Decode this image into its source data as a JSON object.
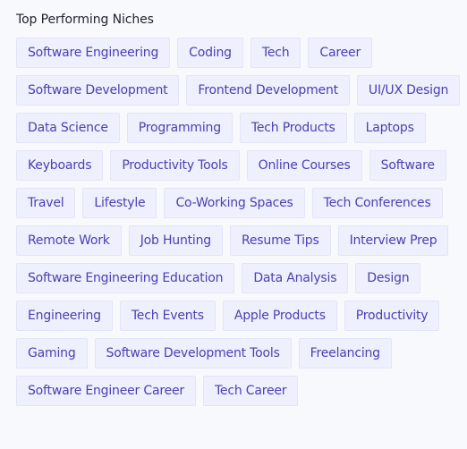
{
  "section": {
    "title": "Top Performing Niches"
  },
  "colors": {
    "tag_text": "#4b40b3",
    "tag_background": "#eef0fd",
    "tag_border": "#e2e5f7",
    "page_background": "#f8f9fc"
  },
  "tags": [
    "Software Engineering",
    "Coding",
    "Tech",
    "Career",
    "Software Development",
    "Frontend Development",
    "UI/UX Design",
    "Data Science",
    "Programming",
    "Tech Products",
    "Laptops",
    "Keyboards",
    "Productivity Tools",
    "Online Courses",
    "Software",
    "Travel",
    "Lifestyle",
    "Co-Working Spaces",
    "Tech Conferences",
    "Remote Work",
    "Job Hunting",
    "Resume Tips",
    "Interview Prep",
    "Software Engineering Education",
    "Data Analysis",
    "Design",
    "Engineering",
    "Tech Events",
    "Apple Products",
    "Productivity",
    "Gaming",
    "Software Development Tools",
    "Freelancing",
    "Software Engineer Career",
    "Tech Career"
  ]
}
